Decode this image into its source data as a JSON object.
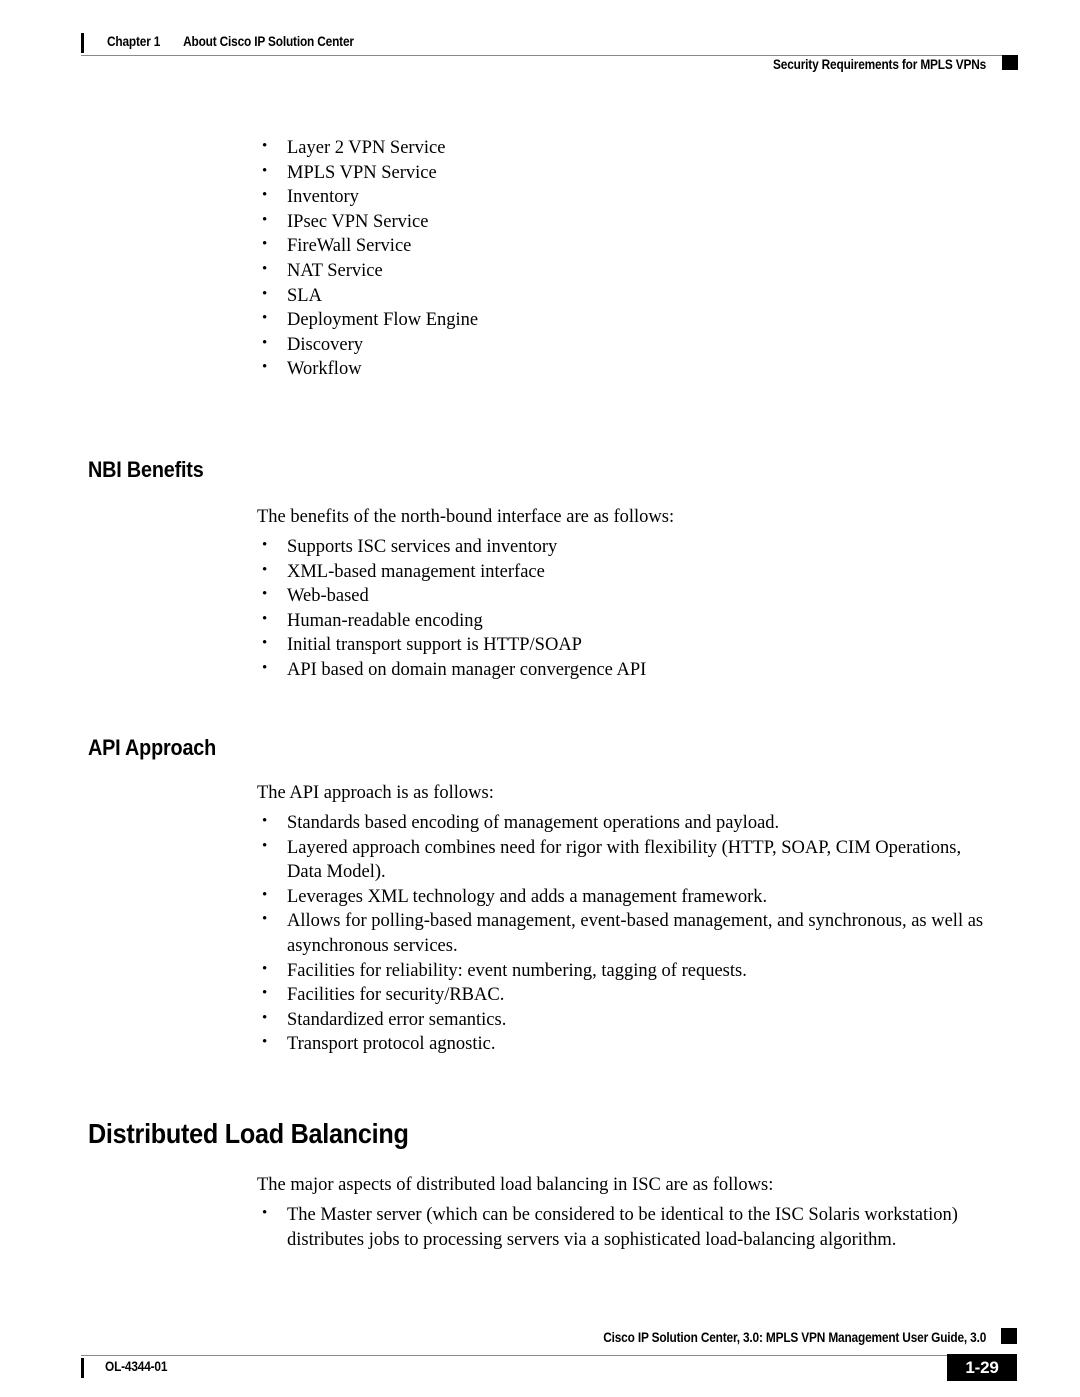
{
  "header": {
    "chapter_label": "Chapter 1",
    "chapter_title": "About Cisco IP Solution Center",
    "running_head_right": "Security Requirements for MPLS VPNs"
  },
  "sections": {
    "services_list": {
      "items": [
        "Layer 2 VPN Service",
        "MPLS VPN Service",
        "Inventory",
        "IPsec VPN Service",
        "FireWall Service",
        "NAT Service",
        "SLA",
        "Deployment Flow Engine",
        "Discovery",
        "Workflow"
      ]
    },
    "nbi_benefits": {
      "heading": "NBI Benefits",
      "intro": "The benefits of the north-bound interface are as follows:",
      "items": [
        "Supports ISC services and inventory",
        "XML-based management interface",
        "Web-based",
        "Human-readable encoding",
        "Initial transport support is HTTP/SOAP",
        "API based on domain manager convergence API"
      ]
    },
    "api_approach": {
      "heading": "API Approach",
      "intro": "The API approach is as follows:",
      "items": [
        "Standards based encoding of management operations and payload.",
        "Layered approach combines need for rigor with flexibility (HTTP, SOAP, CIM Operations, Data Model).",
        "Leverages XML technology and adds a management framework.",
        "Allows for polling-based management, event-based management, and synchronous, as well as asynchronous services.",
        "Facilities for reliability: event numbering, tagging of requests.",
        "Facilities for security/RBAC.",
        "Standardized error semantics.",
        "Transport protocol agnostic."
      ]
    },
    "distributed_load_balancing": {
      "heading": "Distributed Load Balancing",
      "intro": "The major aspects of distributed load balancing in ISC are as follows:",
      "items": [
        "The Master server (which can be considered to be identical to the ISC Solaris workstation) distributes jobs to processing servers via a sophisticated load-balancing algorithm."
      ]
    }
  },
  "footer": {
    "guide_title": "Cisco IP Solution Center, 3.0: MPLS VPN Management User Guide, 3.0",
    "doc_id": "OL-4344-01",
    "page_number": "1-29"
  }
}
